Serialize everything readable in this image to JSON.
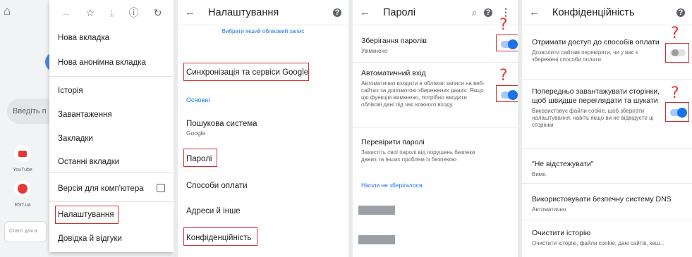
{
  "panel_menu": {
    "search_hint": "Введіть п",
    "tiles": [
      {
        "label": "YouTube"
      },
      {
        "label": "RST.ua"
      }
    ],
    "news_box": "Статті для в",
    "toolbar_icons": [
      "forward-icon",
      "star-icon",
      "download-icon",
      "info-icon",
      "refresh-icon"
    ],
    "items": [
      {
        "label": "Нова вкладка"
      },
      {
        "label": "Нова анонімна вкладка"
      },
      {
        "label": "Історія"
      },
      {
        "label": "Завантаження"
      },
      {
        "label": "Закладки"
      },
      {
        "label": "Останні вкладки"
      },
      {
        "label": "Версія для комп'ютера"
      },
      {
        "label": "Налаштування"
      },
      {
        "label": "Довідка й відгуки"
      }
    ]
  },
  "panel_settings": {
    "title": "Налаштування",
    "account_link": "Вибрати інший обліковий запис",
    "sync": "Синхронізація та сервіси Google",
    "section_basic": "Основні",
    "search_engine": {
      "label": "Пошукова система",
      "value": "Google"
    },
    "passwords": "Паролі",
    "payment": "Способи оплати",
    "addresses": "Адреси й інше",
    "privacy": "Конфіденційність"
  },
  "panel_passwords": {
    "title": "Паролі",
    "save_passwords": {
      "label": "Зберігання паролів",
      "sub": "Увімкнено",
      "on": true
    },
    "auto_signin": {
      "label": "Автоматичний вхід",
      "sub": "Автоматично входити в облікові записи на веб-сайтах за допомогою збережених даних. Якщо цю функцію вимкнено, потрібно вводити облікові дані під час кожного входу.",
      "on": true
    },
    "check": {
      "label": "Перевірити паролі",
      "sub": "Захистіть свої паролі від порушень безпеки даних та інших проблем із безпекою"
    },
    "never_saved": "Ніколи не зберігалося"
  },
  "panel_privacy": {
    "title": "Конфіденційність",
    "payment_access": {
      "label": "Отримати доступ до способів оплати",
      "sub": "Дозволити сайтам перевіряти, чи у вас є збережені способи оплати",
      "on": false
    },
    "preload": {
      "label": "Попередньо завантажувати сторінки, щоб швидше переглядати та шукати",
      "sub": "Використовує файли cookie, щоб зберігати налаштування, навіть якщо ви не відвідуєте ці сторінки",
      "on": true
    },
    "dnt": {
      "label": "\"Не відстежувати\"",
      "sub": "Вимк."
    },
    "dns": {
      "label": "Використовувати безпечну систему DNS",
      "sub": "Автоматично"
    },
    "clear": {
      "label": "Очистити історію",
      "sub": "Очистити історію, файли cookie, дані сайтів, кеш..."
    }
  },
  "annotation": {
    "qmark": "?",
    "color": "#d32f2f"
  },
  "colors": {
    "accent": "#1a73e8",
    "toggle_track": "#a8c7fa"
  }
}
